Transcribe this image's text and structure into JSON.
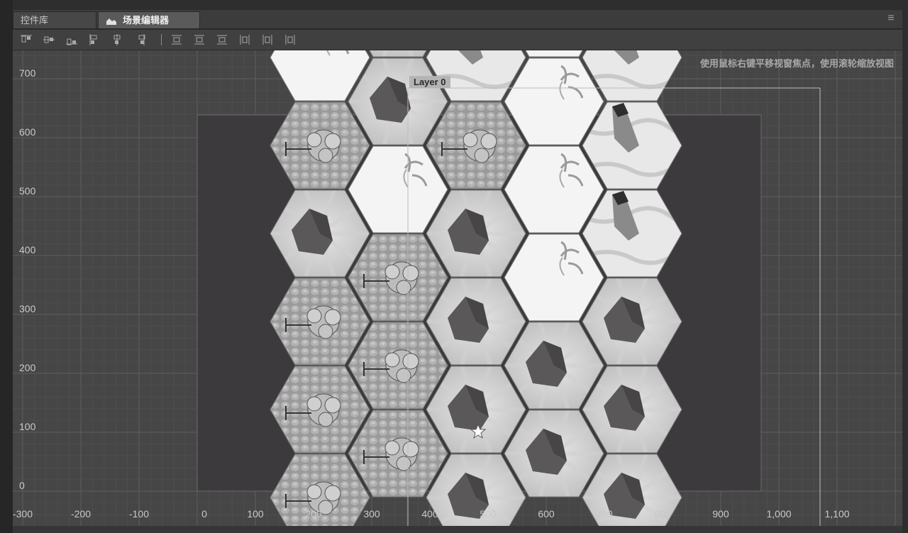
{
  "tabs": [
    {
      "label": "控件库",
      "active": false
    },
    {
      "label": "场景编辑器",
      "active": true
    }
  ],
  "menu_icon": "hamburger-menu-icon",
  "toolbar": {
    "buttons": [
      {
        "name": "align-top-icon"
      },
      {
        "name": "align-vertical-center-icon"
      },
      {
        "name": "align-bottom-icon"
      },
      {
        "name": "align-left-icon"
      },
      {
        "name": "align-horizontal-center-icon"
      },
      {
        "name": "align-right-icon"
      },
      {
        "name": "distribute-top-icon"
      },
      {
        "name": "distribute-vertical-center-icon"
      },
      {
        "name": "distribute-bottom-icon"
      },
      {
        "name": "distribute-left-icon"
      },
      {
        "name": "distribute-horizontal-center-icon"
      },
      {
        "name": "distribute-right-icon"
      }
    ]
  },
  "viewport": {
    "hint": "使用鼠标右键平移视窗焦点，使用滚轮缩放视图",
    "y_labels": [
      "700",
      "600",
      "500",
      "400",
      "300",
      "200",
      "100",
      "0"
    ],
    "x_labels": [
      "-300",
      "-200",
      "-100",
      "0",
      "100",
      "200",
      "300",
      "400",
      "500",
      "600",
      "700",
      "800",
      "900",
      "1,000",
      "1,100"
    ],
    "layer_label": "Layer 0"
  },
  "tiles": {
    "types": [
      "grass-plain",
      "rock",
      "grass-flowers",
      "tree-bush",
      "stone-pillar"
    ],
    "grid": [
      [
        "tree-bush",
        "tree-bush",
        "rock",
        "rock",
        "rock"
      ],
      [
        "tree-bush",
        "tree-bush",
        "rock",
        "rock",
        "rock"
      ],
      [
        "tree-bush",
        "tree-bush",
        "rock",
        "grass-plain",
        "rock"
      ],
      [
        "rock",
        "grass-plain",
        "rock",
        "grass-plain",
        "stone-pillar"
      ],
      [
        "tree-bush",
        "rock",
        "tree-bush",
        "grass-plain",
        "stone-pillar"
      ],
      [
        "grass-plain",
        "rock",
        "stone-pillar",
        "grass-plain",
        "stone-pillar"
      ]
    ]
  },
  "colors": {
    "viewport_bg": "#464646",
    "scene_bg": "#3d3a3d",
    "grid": "#565656",
    "grid_major": "#6a6a6a"
  }
}
